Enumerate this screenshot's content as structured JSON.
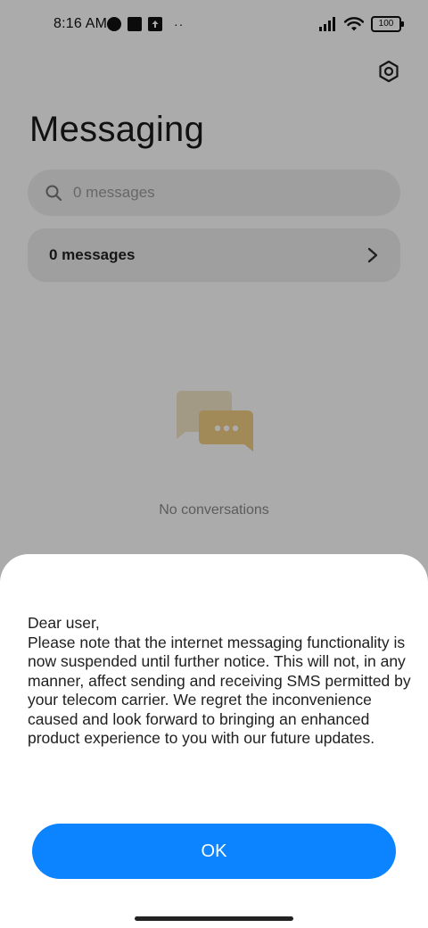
{
  "status_bar": {
    "time": "8:16 AM",
    "battery": "100",
    "extra": "··"
  },
  "header": {
    "title": "Messaging",
    "settings_icon": "gear-icon"
  },
  "search": {
    "placeholder": "0 messages",
    "icon": "search-icon"
  },
  "messages_row": {
    "label": "0 messages",
    "icon": "chevron-right-icon"
  },
  "empty_state": {
    "icon": "chat-bubbles-icon",
    "text": "No conversations"
  },
  "dialog": {
    "message": "Dear user,\nPlease note that the internet messaging functionality is now suspended until further notice. This will not, in any manner, affect sending and receiving SMS permitted by your telecom carrier. We regret the inconvenience caused and look forward to bringing an enhanced product experience to you with our future updates.",
    "ok_label": "OK"
  },
  "colors": {
    "accent": "#0d84ff",
    "scrim": "rgba(0,0,0,0.33)",
    "empty_icon": "#f0c96a"
  }
}
